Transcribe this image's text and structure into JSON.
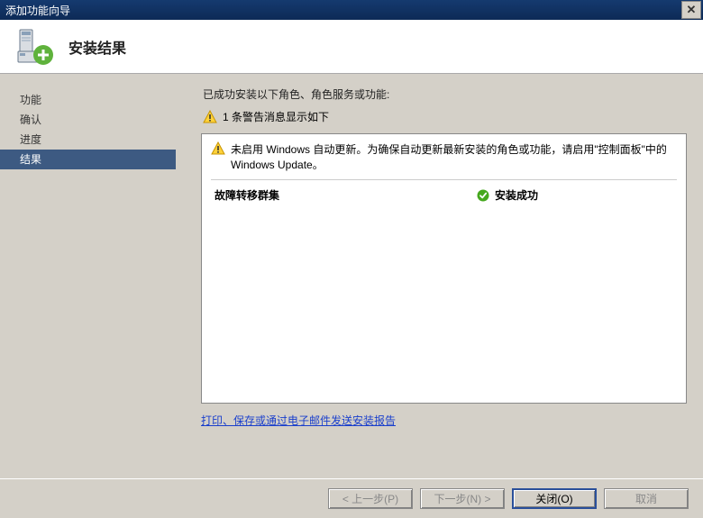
{
  "window": {
    "title": "添加功能向导"
  },
  "header": {
    "title": "安装结果"
  },
  "sidebar": {
    "items": [
      {
        "label": "功能",
        "active": false
      },
      {
        "label": "确认",
        "active": false
      },
      {
        "label": "进度",
        "active": false
      },
      {
        "label": "结果",
        "active": true
      }
    ]
  },
  "main": {
    "intro_text": "已成功安装以下角色、角色服务或功能:",
    "warning_summary": "1 条警告消息显示如下",
    "wu_warning_text": "未启用 Windows 自动更新。为确保自动更新最新安装的角色或功能，请启用\"控制面板\"中的 Windows Update。",
    "feature_name": "故障转移群集",
    "feature_status": "安装成功",
    "report_link": "打印、保存或通过电子邮件发送安装报告"
  },
  "footer": {
    "back": "< 上一步(P)",
    "next": "下一步(N) >",
    "close": "关闭(O)",
    "cancel": "取消"
  }
}
